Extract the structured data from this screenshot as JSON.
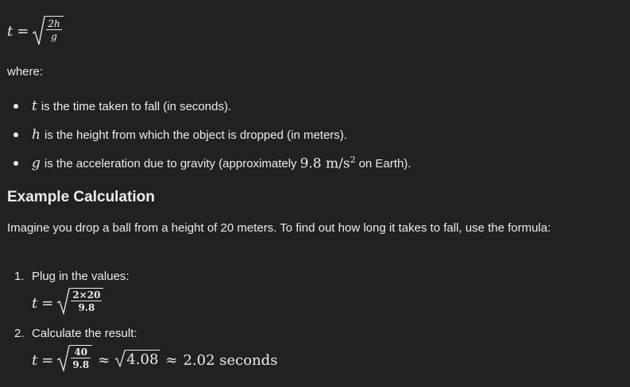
{
  "formula": {
    "lhs": "t",
    "eq": "=",
    "numerator": "2h",
    "denominator": "g"
  },
  "where_label": "where:",
  "variables": [
    {
      "symbol": "t",
      "text": "is the time taken to fall (in seconds)."
    },
    {
      "symbol": "h",
      "text": "is the height from which the object is dropped (in meters)."
    },
    {
      "symbol": "g",
      "text_before": "is the acceleration due to gravity (approximately",
      "value": "9.8 m/s",
      "exponent": "2",
      "text_after": "on Earth)."
    }
  ],
  "section_title": "Example Calculation",
  "intro": "Imagine you drop a ball from a height of 20 meters. To find out how long it takes to fall, use the formula:",
  "steps": [
    {
      "label": "1.",
      "text": "Plug in the values:",
      "lhs": "t",
      "eq": "=",
      "numerator": "2×20",
      "denominator": "9.8"
    },
    {
      "label": "2.",
      "text": "Calculate the result:",
      "lhs": "t",
      "eq": "=",
      "numerator": "40",
      "denominator": "9.8",
      "approx1": "≈",
      "sqrt_value": "4.08",
      "approx2": "≈",
      "result": "2.02 seconds"
    }
  ]
}
